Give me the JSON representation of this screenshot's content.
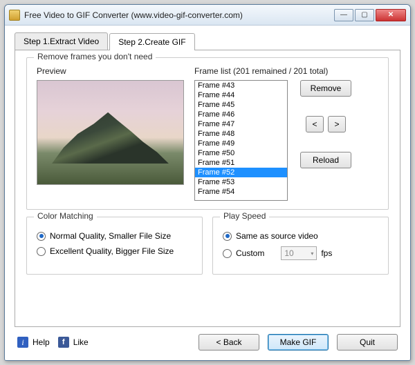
{
  "window": {
    "title": "Free Video to GIF Converter (www.video-gif-converter.com)"
  },
  "tabs": {
    "step1": "Step 1.Extract Video",
    "step2": "Step 2.Create GIF"
  },
  "remove_group": {
    "title": "Remove frames you don't need",
    "preview_label": "Preview",
    "framelist_label": "Frame list (201 remained / 201 total)",
    "frames": [
      "Frame #43",
      "Frame #44",
      "Frame #45",
      "Frame #46",
      "Frame #47",
      "Frame #48",
      "Frame #49",
      "Frame #50",
      "Frame #51",
      "Frame #52",
      "Frame #53",
      "Frame #54"
    ],
    "selected_index": 9,
    "remove_btn": "Remove",
    "prev_btn": "<",
    "next_btn": ">",
    "reload_btn": "Reload"
  },
  "color_group": {
    "title": "Color Matching",
    "opt_normal": "Normal Quality, Smaller File Size",
    "opt_excellent": "Excellent Quality, Bigger File Size",
    "selected": "normal"
  },
  "speed_group": {
    "title": "Play Speed",
    "opt_same": "Same as source video",
    "opt_custom": "Custom",
    "custom_value": "10",
    "custom_suffix": "fps",
    "selected": "same"
  },
  "footer": {
    "help": "Help",
    "like": "Like",
    "back": "< Back",
    "make": "Make GIF",
    "quit": "Quit"
  }
}
